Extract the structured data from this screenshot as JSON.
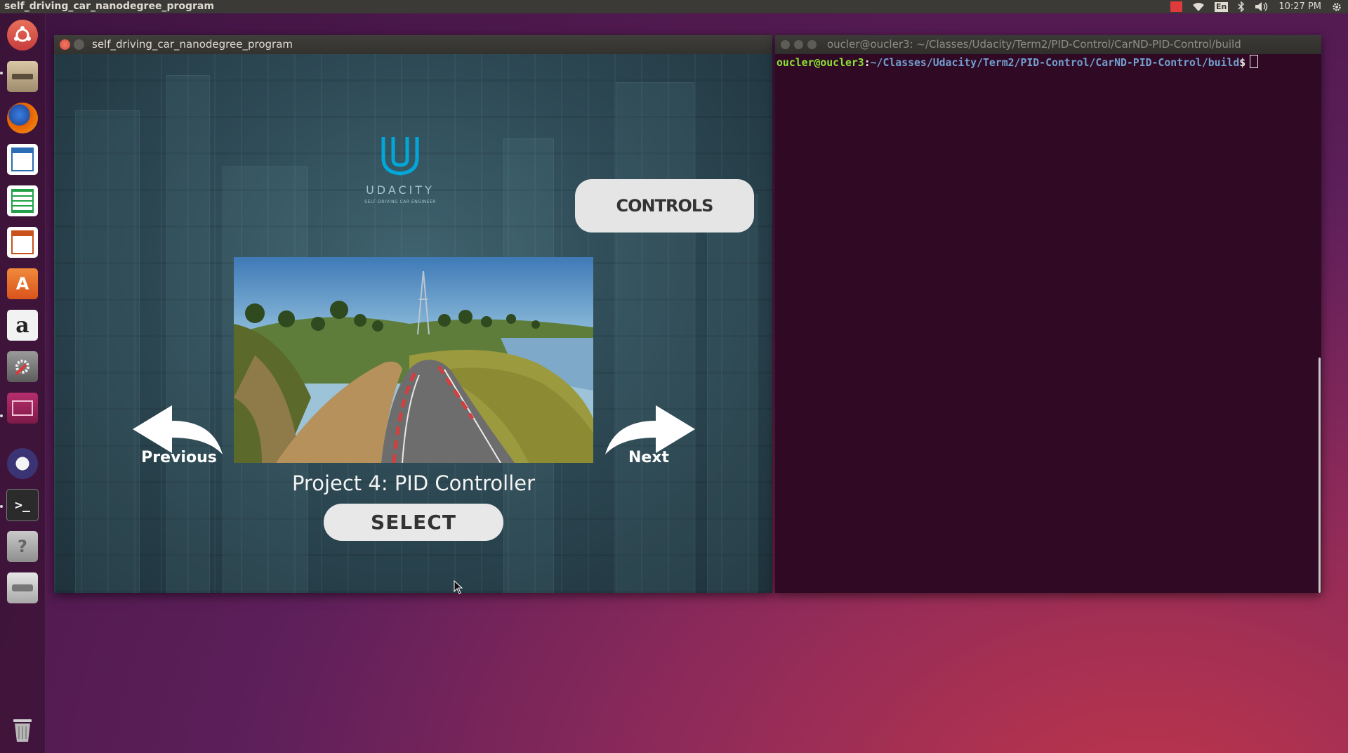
{
  "top_panel": {
    "title": "self_driving_car_nanodegree_program",
    "language": "En",
    "time": "10:27 PM"
  },
  "launcher": {
    "items": [
      {
        "name": "dash-home",
        "color": "#e05c3c"
      },
      {
        "name": "files",
        "color": "#b49a7a"
      },
      {
        "name": "firefox",
        "color": "#e66000"
      },
      {
        "name": "libreoffice-writer",
        "color": "#2b6db4"
      },
      {
        "name": "libreoffice-calc",
        "color": "#22a14a"
      },
      {
        "name": "libreoffice-impress",
        "color": "#c9521c"
      },
      {
        "name": "ubuntu-software",
        "color": "#e9732b"
      },
      {
        "name": "amazon",
        "color": "#e8e8e8"
      },
      {
        "name": "system-settings",
        "color": "#7d7d7d"
      },
      {
        "name": "unity-app",
        "color": "#a5245f"
      },
      {
        "name": "eclipse",
        "color": "#3a3474"
      },
      {
        "name": "terminal",
        "color": "#2b2b2b"
      },
      {
        "name": "help",
        "color": "#a9a9a9"
      },
      {
        "name": "drive",
        "color": "#c8c8c8"
      }
    ],
    "trash": "trash"
  },
  "sim_window": {
    "title": "self_driving_car_nanodegree_program",
    "logo_word": "UDACITY",
    "logo_sub": "SELF-DRIVING CAR ENGINEER",
    "controls_label": "CONTROLS",
    "prev_label": "Previous",
    "next_label": "Next",
    "project_title": "Project 4: PID Controller",
    "select_label": "SELECT"
  },
  "terminal": {
    "title": "oucler@oucler3: ~/Classes/Udacity/Term2/PID-Control/CarND-PID-Control/build",
    "prompt_user": "oucler@oucler3",
    "prompt_sep": ":",
    "prompt_path": "~/Classes/Udacity/Term2/PID-Control/CarND-PID-Control/build",
    "prompt_symbol": "$"
  },
  "colors": {
    "terminal_bg": "#300a24",
    "prompt_user": "#8ae234",
    "prompt_path": "#729fcf",
    "udacity_blue": "#02a7d9"
  }
}
